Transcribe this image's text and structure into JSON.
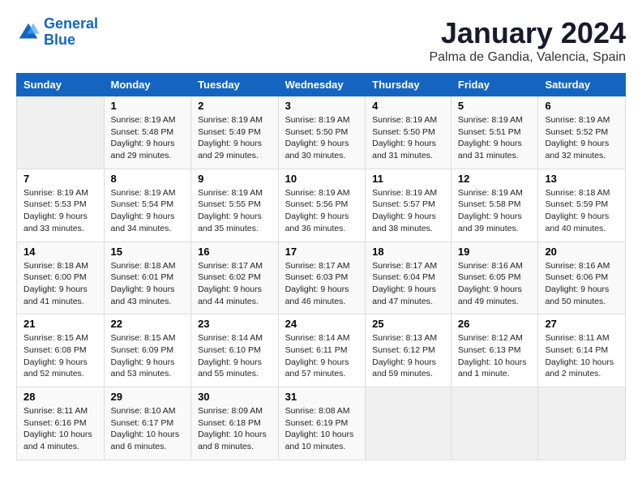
{
  "header": {
    "logo_line1": "General",
    "logo_line2": "Blue",
    "month": "January 2024",
    "location": "Palma de Gandia, Valencia, Spain"
  },
  "weekdays": [
    "Sunday",
    "Monday",
    "Tuesday",
    "Wednesday",
    "Thursday",
    "Friday",
    "Saturday"
  ],
  "weeks": [
    [
      {
        "day": "",
        "info": ""
      },
      {
        "day": "1",
        "info": "Sunrise: 8:19 AM\nSunset: 5:48 PM\nDaylight: 9 hours\nand 29 minutes."
      },
      {
        "day": "2",
        "info": "Sunrise: 8:19 AM\nSunset: 5:49 PM\nDaylight: 9 hours\nand 29 minutes."
      },
      {
        "day": "3",
        "info": "Sunrise: 8:19 AM\nSunset: 5:50 PM\nDaylight: 9 hours\nand 30 minutes."
      },
      {
        "day": "4",
        "info": "Sunrise: 8:19 AM\nSunset: 5:50 PM\nDaylight: 9 hours\nand 31 minutes."
      },
      {
        "day": "5",
        "info": "Sunrise: 8:19 AM\nSunset: 5:51 PM\nDaylight: 9 hours\nand 31 minutes."
      },
      {
        "day": "6",
        "info": "Sunrise: 8:19 AM\nSunset: 5:52 PM\nDaylight: 9 hours\nand 32 minutes."
      }
    ],
    [
      {
        "day": "7",
        "info": "Sunrise: 8:19 AM\nSunset: 5:53 PM\nDaylight: 9 hours\nand 33 minutes."
      },
      {
        "day": "8",
        "info": "Sunrise: 8:19 AM\nSunset: 5:54 PM\nDaylight: 9 hours\nand 34 minutes."
      },
      {
        "day": "9",
        "info": "Sunrise: 8:19 AM\nSunset: 5:55 PM\nDaylight: 9 hours\nand 35 minutes."
      },
      {
        "day": "10",
        "info": "Sunrise: 8:19 AM\nSunset: 5:56 PM\nDaylight: 9 hours\nand 36 minutes."
      },
      {
        "day": "11",
        "info": "Sunrise: 8:19 AM\nSunset: 5:57 PM\nDaylight: 9 hours\nand 38 minutes."
      },
      {
        "day": "12",
        "info": "Sunrise: 8:19 AM\nSunset: 5:58 PM\nDaylight: 9 hours\nand 39 minutes."
      },
      {
        "day": "13",
        "info": "Sunrise: 8:18 AM\nSunset: 5:59 PM\nDaylight: 9 hours\nand 40 minutes."
      }
    ],
    [
      {
        "day": "14",
        "info": "Sunrise: 8:18 AM\nSunset: 6:00 PM\nDaylight: 9 hours\nand 41 minutes."
      },
      {
        "day": "15",
        "info": "Sunrise: 8:18 AM\nSunset: 6:01 PM\nDaylight: 9 hours\nand 43 minutes."
      },
      {
        "day": "16",
        "info": "Sunrise: 8:17 AM\nSunset: 6:02 PM\nDaylight: 9 hours\nand 44 minutes."
      },
      {
        "day": "17",
        "info": "Sunrise: 8:17 AM\nSunset: 6:03 PM\nDaylight: 9 hours\nand 46 minutes."
      },
      {
        "day": "18",
        "info": "Sunrise: 8:17 AM\nSunset: 6:04 PM\nDaylight: 9 hours\nand 47 minutes."
      },
      {
        "day": "19",
        "info": "Sunrise: 8:16 AM\nSunset: 6:05 PM\nDaylight: 9 hours\nand 49 minutes."
      },
      {
        "day": "20",
        "info": "Sunrise: 8:16 AM\nSunset: 6:06 PM\nDaylight: 9 hours\nand 50 minutes."
      }
    ],
    [
      {
        "day": "21",
        "info": "Sunrise: 8:15 AM\nSunset: 6:08 PM\nDaylight: 9 hours\nand 52 minutes."
      },
      {
        "day": "22",
        "info": "Sunrise: 8:15 AM\nSunset: 6:09 PM\nDaylight: 9 hours\nand 53 minutes."
      },
      {
        "day": "23",
        "info": "Sunrise: 8:14 AM\nSunset: 6:10 PM\nDaylight: 9 hours\nand 55 minutes."
      },
      {
        "day": "24",
        "info": "Sunrise: 8:14 AM\nSunset: 6:11 PM\nDaylight: 9 hours\nand 57 minutes."
      },
      {
        "day": "25",
        "info": "Sunrise: 8:13 AM\nSunset: 6:12 PM\nDaylight: 9 hours\nand 59 minutes."
      },
      {
        "day": "26",
        "info": "Sunrise: 8:12 AM\nSunset: 6:13 PM\nDaylight: 10 hours\nand 1 minute."
      },
      {
        "day": "27",
        "info": "Sunrise: 8:11 AM\nSunset: 6:14 PM\nDaylight: 10 hours\nand 2 minutes."
      }
    ],
    [
      {
        "day": "28",
        "info": "Sunrise: 8:11 AM\nSunset: 6:16 PM\nDaylight: 10 hours\nand 4 minutes."
      },
      {
        "day": "29",
        "info": "Sunrise: 8:10 AM\nSunset: 6:17 PM\nDaylight: 10 hours\nand 6 minutes."
      },
      {
        "day": "30",
        "info": "Sunrise: 8:09 AM\nSunset: 6:18 PM\nDaylight: 10 hours\nand 8 minutes."
      },
      {
        "day": "31",
        "info": "Sunrise: 8:08 AM\nSunset: 6:19 PM\nDaylight: 10 hours\nand 10 minutes."
      },
      {
        "day": "",
        "info": ""
      },
      {
        "day": "",
        "info": ""
      },
      {
        "day": "",
        "info": ""
      }
    ]
  ]
}
